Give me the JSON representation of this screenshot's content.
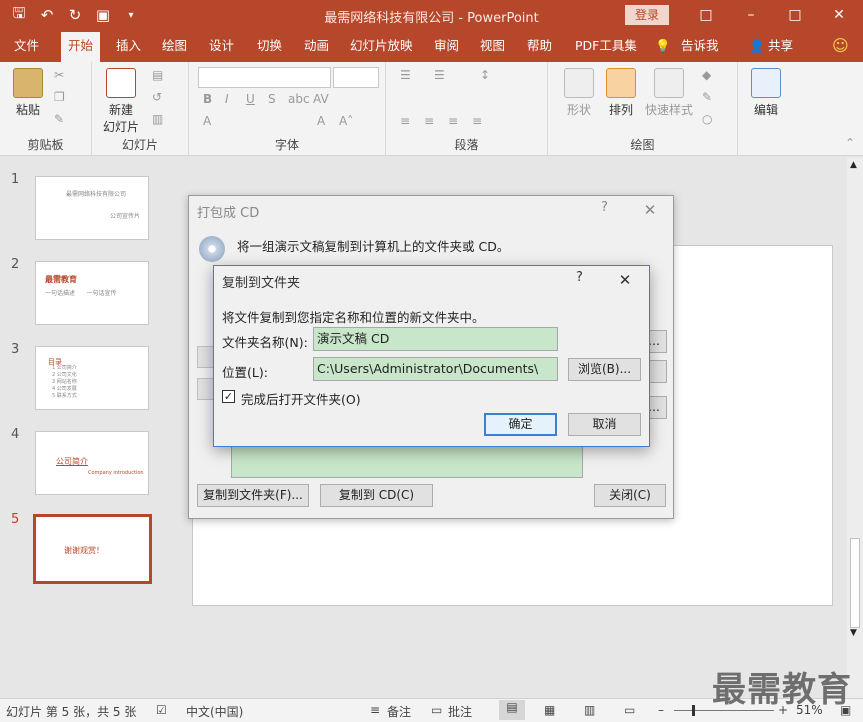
{
  "window": {
    "title": "最需网络科技有限公司  -  PowerPoint",
    "login_label": "登录"
  },
  "qat": {
    "icons": [
      "save-icon",
      "undo-icon",
      "redo-icon",
      "present-icon",
      "customize-icon"
    ]
  },
  "tabs": [
    {
      "label": "文件"
    },
    {
      "label": "开始"
    },
    {
      "label": "插入"
    },
    {
      "label": "绘图"
    },
    {
      "label": "设计"
    },
    {
      "label": "切换"
    },
    {
      "label": "动画"
    },
    {
      "label": "幻灯片放映"
    },
    {
      "label": "审阅"
    },
    {
      "label": "视图"
    },
    {
      "label": "帮助"
    },
    {
      "label": "PDF工具集"
    },
    {
      "label": "告诉我"
    },
    {
      "label": "共享"
    }
  ],
  "ribbon": {
    "paste_label": "粘贴",
    "new_slide_label": "新建\n幻灯片",
    "shape_label": "形状",
    "arrange_label": "排列",
    "quick_style_label": "快速样式",
    "edit_label": "编辑",
    "groups": [
      {
        "label": "剪贴板"
      },
      {
        "label": "幻灯片"
      },
      {
        "label": "字体"
      },
      {
        "label": "段落"
      },
      {
        "label": "绘图"
      }
    ]
  },
  "slides": [
    {
      "num": "1",
      "t1": "最需网络科技有限公司",
      "t2": "公司宣传片"
    },
    {
      "num": "2",
      "t1": "最需教育",
      "t2": "一句话描述      一句话宣传"
    },
    {
      "num": "3",
      "t1": "目录",
      "t2": "1 公司简介\n2 公司文化\n3 网站名称\n4 公司发展\n5 联系方式"
    },
    {
      "num": "4",
      "t1": "公司简介",
      "t2": "Company introduction"
    },
    {
      "num": "5",
      "t1": "谢谢观赏！",
      "t2": ""
    }
  ],
  "dialog_package": {
    "title": "打包成 CD",
    "help": "?",
    "description": "将一组演示文稿复制到计算机上的文件夹或 CD。",
    "copy_to_folder_button": "复制到文件夹(F)...",
    "copy_to_cd_button": "复制到 CD(C)",
    "close_button": "关闭(C)"
  },
  "dialog_copy": {
    "title": "复制到文件夹",
    "help": "?",
    "description": "将文件复制到您指定名称和位置的新文件夹中。",
    "folder_name_label": "文件夹名称(N):",
    "folder_name_value": "演示文稿 CD",
    "location_label": "位置(L):",
    "location_value": "C:\\Users\\Administrator\\Documents\\",
    "browse_button": "浏览(B)...",
    "open_after_label": "完成后打开文件夹(O)",
    "open_after_checked": true,
    "ok_button": "确定",
    "cancel_button": "取消"
  },
  "statusbar": {
    "slide_info": "幻灯片 第 5 张，共 5 张",
    "language": "中文(中国)",
    "notes_label": "备注",
    "comments_label": "批注",
    "zoom": "51%"
  },
  "watermark": "最需教育",
  "colors": {
    "accent": "#b7472a",
    "field_highlight": "#c8e6c9",
    "dialog_focus": "#3c7fd3"
  }
}
